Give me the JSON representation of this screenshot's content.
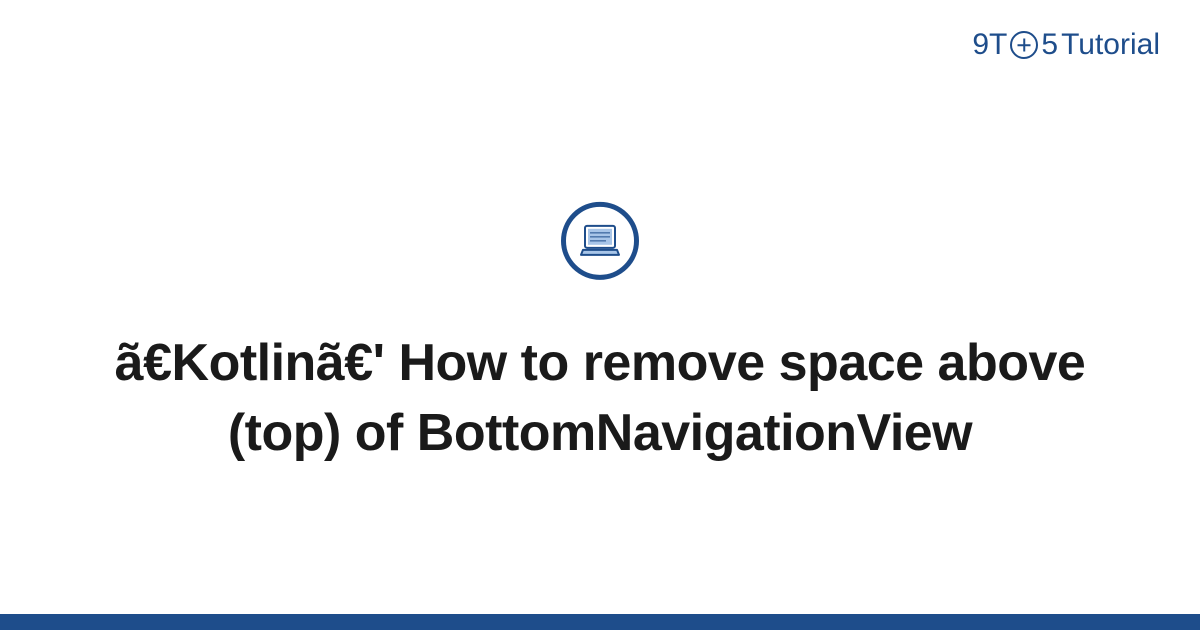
{
  "logo": {
    "part1": "9T",
    "part2": "5",
    "part3": "Tutorial"
  },
  "title": "ã€Kotlinã€' How to remove space above (top) of BottomNavigationView",
  "colors": {
    "brand": "#1e4d8b",
    "icon_fill": "#a8c5e8"
  }
}
